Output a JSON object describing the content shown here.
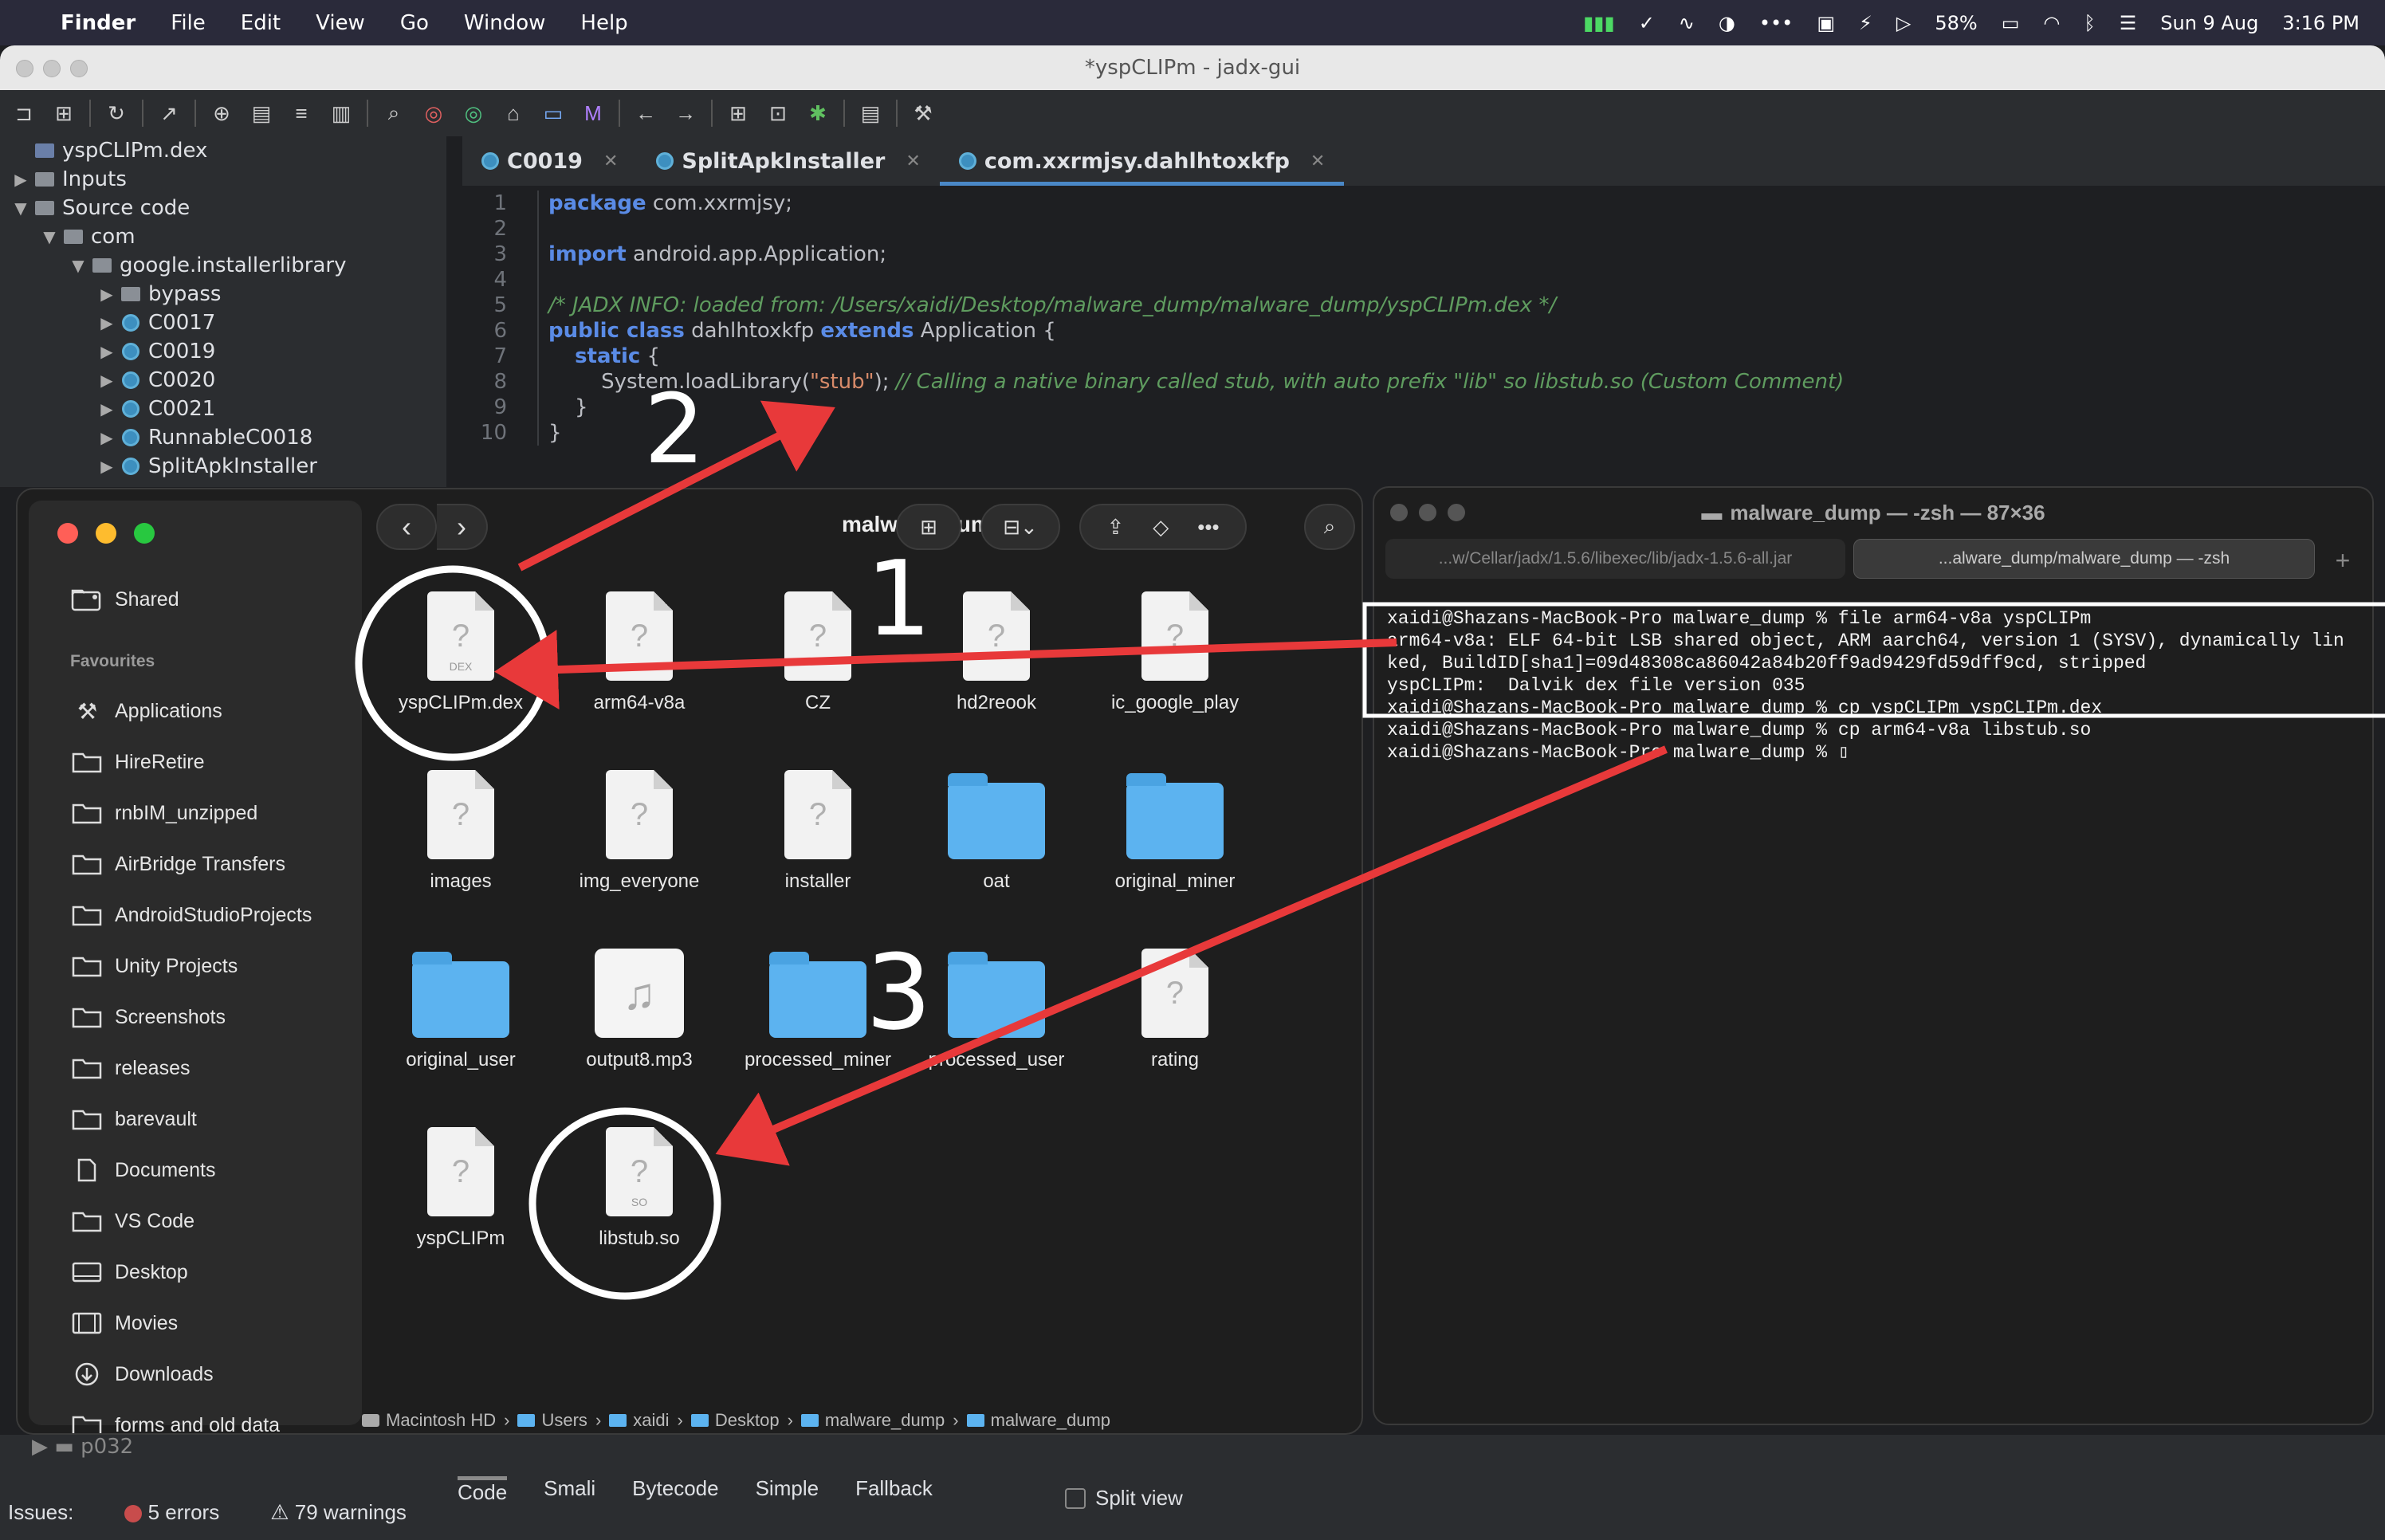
{
  "menubar": {
    "app": "Finder",
    "items": [
      "File",
      "Edit",
      "View",
      "Go",
      "Window",
      "Help"
    ],
    "battery": "58%",
    "date": "Sun 9 Aug",
    "time": "3:16 PM"
  },
  "ide": {
    "title": "*yspCLIPm - jadx-gui"
  },
  "tree": {
    "items": [
      {
        "label": "yspCLIPm.dex",
        "indent": 0,
        "arrow": "",
        "icon": "file"
      },
      {
        "label": "Inputs",
        "indent": 0,
        "arrow": "▶",
        "icon": "folder"
      },
      {
        "label": "Source code",
        "indent": 0,
        "arrow": "▼",
        "icon": "pkg"
      },
      {
        "label": "com",
        "indent": 1,
        "arrow": "▼",
        "icon": "folder"
      },
      {
        "label": "google.installerlibrary",
        "indent": 2,
        "arrow": "▼",
        "icon": "folder"
      },
      {
        "label": "bypass",
        "indent": 3,
        "arrow": "▶",
        "icon": "folder"
      },
      {
        "label": "C0017",
        "indent": 3,
        "arrow": "▶",
        "icon": "class"
      },
      {
        "label": "C0019",
        "indent": 3,
        "arrow": "▶",
        "icon": "class"
      },
      {
        "label": "C0020",
        "indent": 3,
        "arrow": "▶",
        "icon": "class"
      },
      {
        "label": "C0021",
        "indent": 3,
        "arrow": "▶",
        "icon": "class"
      },
      {
        "label": "RunnableC0018",
        "indent": 3,
        "arrow": "▶",
        "icon": "class"
      },
      {
        "label": "SplitApkInstaller",
        "indent": 3,
        "arrow": "▶",
        "icon": "class"
      }
    ]
  },
  "tabs": [
    {
      "label": "C0019",
      "active": false
    },
    {
      "label": "SplitApkInstaller",
      "active": false
    },
    {
      "label": "com.xxrmjsy.dahlhtoxkfp",
      "active": true
    }
  ],
  "editor": {
    "line_numbers": [
      "1",
      "2",
      "3",
      "4",
      "5",
      "6",
      "7",
      "8",
      "9",
      "10"
    ],
    "lines": [
      [
        {
          "t": "package",
          "c": "kw"
        },
        {
          "t": " com.xxrmjsy;",
          "c": ""
        }
      ],
      [],
      [
        {
          "t": "import",
          "c": "kw"
        },
        {
          "t": " android.app.Application;",
          "c": ""
        }
      ],
      [],
      [
        {
          "t": "/* JADX INFO: loaded from: /Users/xaidi/Desktop/malware_dump/malware_dump/yspCLIPm.dex */",
          "c": "cm"
        }
      ],
      [
        {
          "t": "public class",
          "c": "kw"
        },
        {
          "t": " dahlhtoxkfp ",
          "c": ""
        },
        {
          "t": "extends",
          "c": "kw"
        },
        {
          "t": " Application ",
          "c": ""
        },
        {
          "t": "{",
          "c": ""
        }
      ],
      [
        {
          "t": "    ",
          "c": ""
        },
        {
          "t": "static",
          "c": "kw"
        },
        {
          "t": " {",
          "c": ""
        }
      ],
      [
        {
          "t": "        System.loadLibrary(",
          "c": ""
        },
        {
          "t": "\"stub\"",
          "c": "st"
        },
        {
          "t": "); ",
          "c": ""
        },
        {
          "t": "// Calling a native binary called stub, with auto prefix \"lib\" so libstub.so (Custom Comment)",
          "c": "cm"
        }
      ],
      [
        {
          "t": "    }",
          "c": ""
        }
      ],
      [
        {
          "t": "}",
          "c": ""
        }
      ]
    ]
  },
  "finder": {
    "title": "malware_dump",
    "sidebar": {
      "shared": "Shared",
      "favourites_label": "Favourites",
      "items": [
        "Applications",
        "HireRetire",
        "rnbIM_unzipped",
        "AirBridge Transfers",
        "AndroidStudioProjects",
        "Unity Projects",
        "Screenshots",
        "releases",
        "barevault",
        "Documents",
        "VS Code",
        "Desktop",
        "Movies",
        "Downloads",
        "forms and old data"
      ]
    },
    "files": [
      {
        "name": "yspCLIPm.dex",
        "kind": "doc",
        "tag": "DEX"
      },
      {
        "name": "arm64-v8a",
        "kind": "doc",
        "tag": ""
      },
      {
        "name": "CZ",
        "kind": "doc",
        "tag": ""
      },
      {
        "name": "hd2reook",
        "kind": "doc",
        "tag": ""
      },
      {
        "name": "ic_google_play",
        "kind": "doc",
        "tag": ""
      },
      {
        "name": "images",
        "kind": "doc",
        "tag": ""
      },
      {
        "name": "img_everyone",
        "kind": "doc",
        "tag": ""
      },
      {
        "name": "installer",
        "kind": "doc",
        "tag": ""
      },
      {
        "name": "oat",
        "kind": "folder",
        "tag": ""
      },
      {
        "name": "original_miner",
        "kind": "folder",
        "tag": ""
      },
      {
        "name": "original_user",
        "kind": "folder",
        "tag": ""
      },
      {
        "name": "output8.mp3",
        "kind": "mp3",
        "tag": ""
      },
      {
        "name": "processed_miner",
        "kind": "folder",
        "tag": ""
      },
      {
        "name": "processed_user",
        "kind": "folder",
        "tag": ""
      },
      {
        "name": "rating",
        "kind": "doc",
        "tag": ""
      },
      {
        "name": "yspCLIPm",
        "kind": "doc",
        "tag": ""
      },
      {
        "name": "libstub.so",
        "kind": "doc",
        "tag": "SO"
      }
    ],
    "path": [
      "Macintosh HD",
      "Users",
      "xaidi",
      "Desktop",
      "malware_dump",
      "malware_dump"
    ]
  },
  "terminal": {
    "title": "malware_dump — -zsh — 87×36",
    "tabs": [
      "...w/Cellar/jadx/1.5.6/libexec/lib/jadx-1.5.6-all.jar",
      "...alware_dump/malware_dump — -zsh"
    ],
    "lines": [
      "xaidi@Shazans-MacBook-Pro malware_dump % file arm64-v8a yspCLIPm",
      "arm64-v8a: ELF 64-bit LSB shared object, ARM aarch64, version 1 (SYSV), dynamically lin",
      "ked, BuildID[sha1]=09d48308ca86042a84b20ff9ad9429fd59dff9cd, stripped",
      "yspCLIPm:  Dalvik dex file version 035",
      "xaidi@Shazans-MacBook-Pro malware_dump % cp yspCLIPm yspCLIPm.dex",
      "xaidi@Shazans-MacBook-Pro malware_dump % cp arm64-v8a libstub.so",
      "xaidi@Shazans-MacBook-Pro malware_dump % ▯"
    ]
  },
  "bottom": {
    "tabs": [
      "Code",
      "Smali",
      "Bytecode",
      "Simple",
      "Fallback"
    ],
    "split_view": "Split view",
    "issues_label": "Issues:",
    "errors": "5 errors",
    "warnings": "79 warnings",
    "tree_item": "p032"
  },
  "annotations": {
    "step1": "1",
    "step2": "2",
    "step3": "3",
    "arrow_color": "#e8393a"
  },
  "colors": {
    "keyword": "#5a8be6",
    "comment": "#5f9c5f",
    "string": "#d88b6a",
    "folder": "#5cb3f0"
  }
}
